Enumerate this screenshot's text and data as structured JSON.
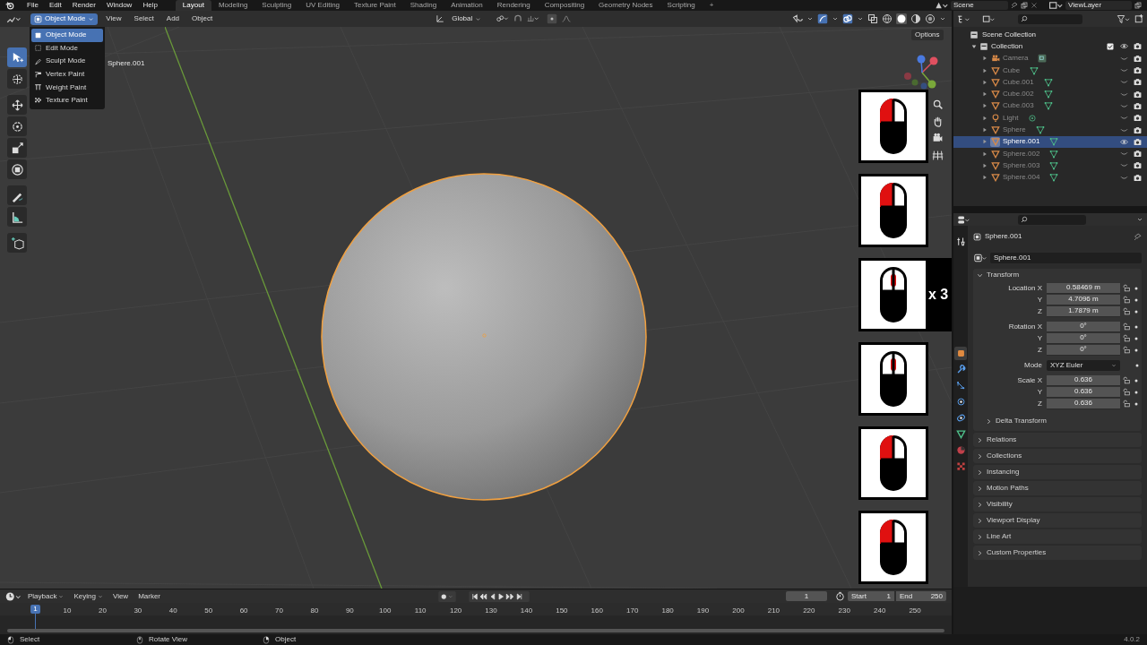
{
  "menu_bar": {
    "items": [
      "File",
      "Edit",
      "Render",
      "Window",
      "Help"
    ]
  },
  "workspaces": [
    {
      "label": "Layout",
      "selected": true
    },
    {
      "label": "Modeling",
      "selected": false
    },
    {
      "label": "Sculpting",
      "selected": false
    },
    {
      "label": "UV Editing",
      "selected": false
    },
    {
      "label": "Texture Paint",
      "selected": false
    },
    {
      "label": "Shading",
      "selected": false
    },
    {
      "label": "Animation",
      "selected": false
    },
    {
      "label": "Rendering",
      "selected": false
    },
    {
      "label": "Compositing",
      "selected": false
    },
    {
      "label": "Geometry Nodes",
      "selected": false
    },
    {
      "label": "Scripting",
      "selected": false
    },
    {
      "label": "+",
      "selected": false
    }
  ],
  "scene": "Scene",
  "view_layer": "ViewLayer",
  "header": {
    "mode": "Object Mode",
    "menus": [
      "View",
      "Select",
      "Add",
      "Object"
    ],
    "orientation": "Global"
  },
  "mode_menu": [
    {
      "label": "Object Mode",
      "selected": true
    },
    {
      "label": "Edit Mode",
      "selected": false
    },
    {
      "label": "Sculpt Mode",
      "selected": false
    },
    {
      "label": "Vertex Paint",
      "selected": false
    },
    {
      "label": "Weight Paint",
      "selected": false
    },
    {
      "label": "Texture Paint",
      "selected": false
    }
  ],
  "tools": [
    {
      "kind": "select",
      "selected": true
    },
    {
      "kind": "cursor",
      "selected": false
    },
    {
      "kind": "move",
      "selected": false
    },
    {
      "kind": "rotate",
      "selected": false
    },
    {
      "kind": "scale",
      "selected": false
    },
    {
      "kind": "transform",
      "selected": false
    },
    {
      "kind": "annotate",
      "selected": false
    },
    {
      "kind": "measure",
      "selected": false
    },
    {
      "kind": "add",
      "selected": false
    }
  ],
  "viewport": {
    "object_label": "Sphere.001",
    "options": "Options"
  },
  "mouse_hints": [
    {
      "kind": "left"
    },
    {
      "kind": "left"
    },
    {
      "kind": "middle",
      "count": "x 3"
    },
    {
      "kind": "middle"
    },
    {
      "kind": "left"
    },
    {
      "kind": "left"
    }
  ],
  "outliner": {
    "root": "Scene Collection",
    "children": [
      {
        "name": "Collection",
        "kind": "collection",
        "visible": true,
        "selected": false,
        "checked": true,
        "children": [
          {
            "name": "Camera",
            "kind": "camera",
            "visible": false,
            "selected": false
          },
          {
            "name": "Cube",
            "kind": "mesh",
            "visible": false,
            "selected": false
          },
          {
            "name": "Cube.001",
            "kind": "mesh",
            "visible": false,
            "selected": false
          },
          {
            "name": "Cube.002",
            "kind": "mesh",
            "visible": false,
            "selected": false
          },
          {
            "name": "Cube.003",
            "kind": "mesh",
            "visible": false,
            "selected": false
          },
          {
            "name": "Light",
            "kind": "light",
            "visible": false,
            "selected": false
          },
          {
            "name": "Sphere",
            "kind": "mesh",
            "visible": false,
            "selected": false
          },
          {
            "name": "Sphere.001",
            "kind": "mesh",
            "visible": true,
            "selected": true
          },
          {
            "name": "Sphere.002",
            "kind": "mesh",
            "visible": false,
            "selected": false
          },
          {
            "name": "Sphere.003",
            "kind": "mesh",
            "visible": false,
            "selected": false
          },
          {
            "name": "Sphere.004",
            "kind": "mesh",
            "visible": false,
            "selected": false
          }
        ]
      }
    ]
  },
  "properties": {
    "tabs": [
      {
        "kind": "tool",
        "selected": false
      },
      {
        "kind": "object",
        "selected": true
      },
      {
        "kind": "modifier",
        "selected": false
      },
      {
        "kind": "particles",
        "selected": false
      },
      {
        "kind": "physics",
        "selected": false
      },
      {
        "kind": "constraints",
        "selected": false
      },
      {
        "kind": "data",
        "selected": false
      },
      {
        "kind": "material",
        "selected": false
      },
      {
        "kind": "texture",
        "selected": false
      }
    ],
    "object_name": "Sphere.001",
    "data_name": "Sphere.001",
    "transform": {
      "title": "Transform",
      "expanded": true,
      "groups": [
        {
          "rows": [
            {
              "kind": "field",
              "label": "Location X",
              "value": "0.58469 m"
            },
            {
              "kind": "field",
              "label": "Y",
              "value": "4.7096 m"
            },
            {
              "kind": "field",
              "label": "Z",
              "value": "1.7879 m"
            }
          ]
        },
        {
          "rows": [
            {
              "kind": "field",
              "label": "Rotation X",
              "value": "0°"
            },
            {
              "kind": "field",
              "label": "Y",
              "value": "0°"
            },
            {
              "kind": "field",
              "label": "Z",
              "value": "0°"
            }
          ]
        },
        {
          "rows": [
            {
              "kind": "dropdown",
              "label": "Mode",
              "value": "XYZ Euler"
            }
          ]
        },
        {
          "rows": [
            {
              "kind": "field",
              "label": "Scale X",
              "value": "0.636"
            },
            {
              "kind": "field",
              "label": "Y",
              "value": "0.636"
            },
            {
              "kind": "field",
              "label": "Z",
              "value": "0.636"
            }
          ]
        }
      ],
      "subpanels": [
        {
          "title": "Delta Transform",
          "expanded": false
        }
      ]
    },
    "panels": [
      {
        "title": "Relations",
        "expanded": false
      },
      {
        "title": "Collections",
        "expanded": false
      },
      {
        "title": "Instancing",
        "expanded": false
      },
      {
        "title": "Motion Paths",
        "expanded": false
      },
      {
        "title": "Visibility",
        "expanded": false
      },
      {
        "title": "Viewport Display",
        "expanded": false
      },
      {
        "title": "Line Art",
        "expanded": false
      },
      {
        "title": "Custom Properties",
        "expanded": false
      }
    ]
  },
  "timeline": {
    "menus": [
      "Playback",
      "Keying",
      "View",
      "Marker"
    ],
    "current_frame": "1",
    "start_label": "Start",
    "start": "1",
    "end_label": "End",
    "end": "250",
    "playhead": "1",
    "ticks": [
      "10",
      "20",
      "30",
      "40",
      "50",
      "60",
      "70",
      "80",
      "90",
      "100",
      "110",
      "120",
      "130",
      "140",
      "150",
      "160",
      "170",
      "180",
      "190",
      "200",
      "210",
      "220",
      "230",
      "240",
      "250"
    ]
  },
  "status_bar": {
    "hints": [
      {
        "kind": "left",
        "label": "Select"
      },
      {
        "kind": "middle",
        "label": "Rotate View"
      },
      {
        "kind": "right",
        "label": "Object"
      }
    ],
    "version": "4.0.2"
  }
}
